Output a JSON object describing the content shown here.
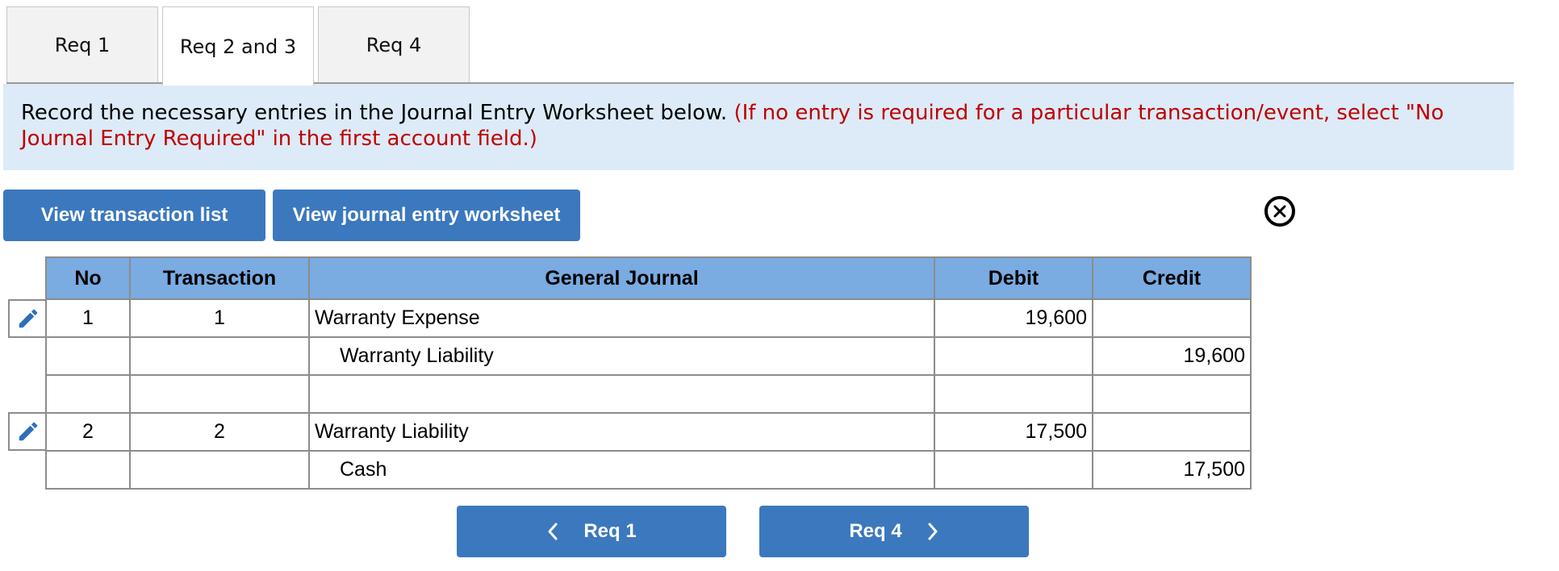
{
  "tabs": [
    {
      "label": "Req 1",
      "active": false
    },
    {
      "label": "Req 2 and 3",
      "active": true
    },
    {
      "label": "Req 4",
      "active": false
    }
  ],
  "instructions": {
    "text": "Record the necessary entries in the Journal Entry Worksheet below.",
    "note": "(If no entry is required for a particular transaction/event, select \"No Journal Entry Required\" in the first account field.)"
  },
  "buttons": {
    "view_transaction_list": "View transaction list",
    "view_journal_entry_worksheet": "View journal entry worksheet",
    "prev": "Req 1",
    "next": "Req 4"
  },
  "table": {
    "headers": [
      "No",
      "Transaction",
      "General Journal",
      "Debit",
      "Credit"
    ],
    "rows": [
      {
        "no": "1",
        "transaction": "1",
        "account": "Warranty Expense",
        "debit": "19,600",
        "credit": "",
        "indent": false,
        "editable": true
      },
      {
        "no": "",
        "transaction": "",
        "account": "Warranty Liability",
        "debit": "",
        "credit": "19,600",
        "indent": true,
        "editable": false
      },
      {
        "no": "",
        "transaction": "",
        "account": "",
        "debit": "",
        "credit": "",
        "indent": false,
        "editable": false
      },
      {
        "no": "2",
        "transaction": "2",
        "account": "Warranty Liability",
        "debit": "17,500",
        "credit": "",
        "indent": false,
        "editable": true
      },
      {
        "no": "",
        "transaction": "",
        "account": "Cash",
        "debit": "",
        "credit": "17,500",
        "indent": true,
        "editable": false
      }
    ]
  },
  "colors": {
    "button": "#3c78be",
    "header": "#7aabe1",
    "banner": "#dcebf7",
    "note_red": "#c00000",
    "edit_icon": "#2f6fb7"
  },
  "icons": {
    "close": "close-circle-icon",
    "edit": "pencil-icon",
    "prev": "chevron-left-icon",
    "next": "chevron-right-icon"
  }
}
